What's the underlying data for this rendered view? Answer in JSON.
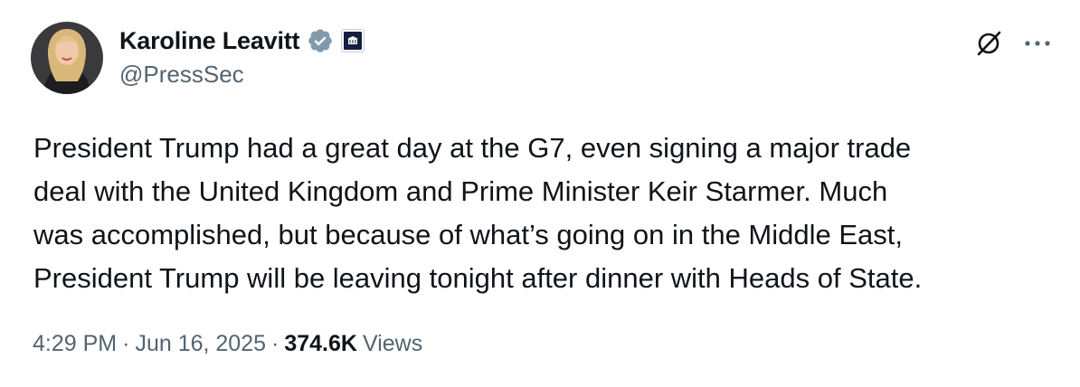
{
  "author": {
    "display_name": "Karoline Leavitt",
    "handle": "@PressSec",
    "verified_badge_color": "#829aab",
    "affiliation_badge": "white-house-icon"
  },
  "tweet": {
    "text": "President Trump had a great day at the G7, even signing a major trade\ndeal with the United Kingdom and Prime Minister Keir Starmer. Much\nwas accomplished, but because of what’s going on in the Middle East,\nPresident Trump will be leaving tonight after dinner with Heads of State."
  },
  "meta": {
    "time": "4:29 PM",
    "separator": "·",
    "date": "Jun 16, 2025",
    "views_count": "374.6K",
    "views_label": "Views"
  },
  "icons": {
    "grok": "grok-icon",
    "more": "more-options-icon"
  },
  "colors": {
    "text_primary": "#0f1419",
    "text_secondary": "#536471",
    "background": "#ffffff"
  }
}
